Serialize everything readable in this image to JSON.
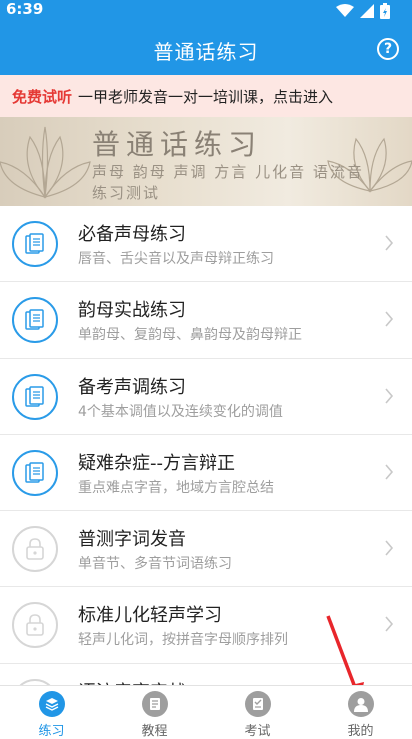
{
  "status": {
    "time": "6:39"
  },
  "header": {
    "title": "普通话练习",
    "help": "?"
  },
  "promo": {
    "highlight": "免费试听",
    "text": "一甲老师发音一对一培训课，点击进入"
  },
  "banner": {
    "title": "普通话练习",
    "line1": "声母 韵母 声调 方言 儿化音 语流音",
    "line2": "练习测试"
  },
  "items": [
    {
      "title": "必备声母练习",
      "desc": "唇音、舌尖音以及声母辩正练习",
      "locked": false
    },
    {
      "title": "韵母实战练习",
      "desc": "单韵母、复韵母、鼻韵母及韵母辩正",
      "locked": false
    },
    {
      "title": "备考声调练习",
      "desc": "4个基本调值以及连续变化的调值",
      "locked": false
    },
    {
      "title": "疑难杂症--方言辩正",
      "desc": "重点难点字音，地域方言腔总结",
      "locked": false
    },
    {
      "title": "普测字词发音",
      "desc": "单音节、多音节词语练习",
      "locked": true
    },
    {
      "title": "标准儿化轻声学习",
      "desc": "轻声儿化词，按拼音字母顺序排列",
      "locked": true
    },
    {
      "title": "语流音变实战",
      "desc": "",
      "locked": true
    }
  ],
  "tabs": [
    {
      "label": "练习",
      "icon": "layers-icon",
      "active": true
    },
    {
      "label": "教程",
      "icon": "book-icon",
      "active": false
    },
    {
      "label": "考试",
      "icon": "exam-icon",
      "active": false
    },
    {
      "label": "我的",
      "icon": "user-icon",
      "active": false
    }
  ],
  "colors": {
    "primary": "#2196e6",
    "promo_bg": "#fde7e3",
    "promo_red": "#e53935",
    "annotation_red": "#e8262b"
  }
}
